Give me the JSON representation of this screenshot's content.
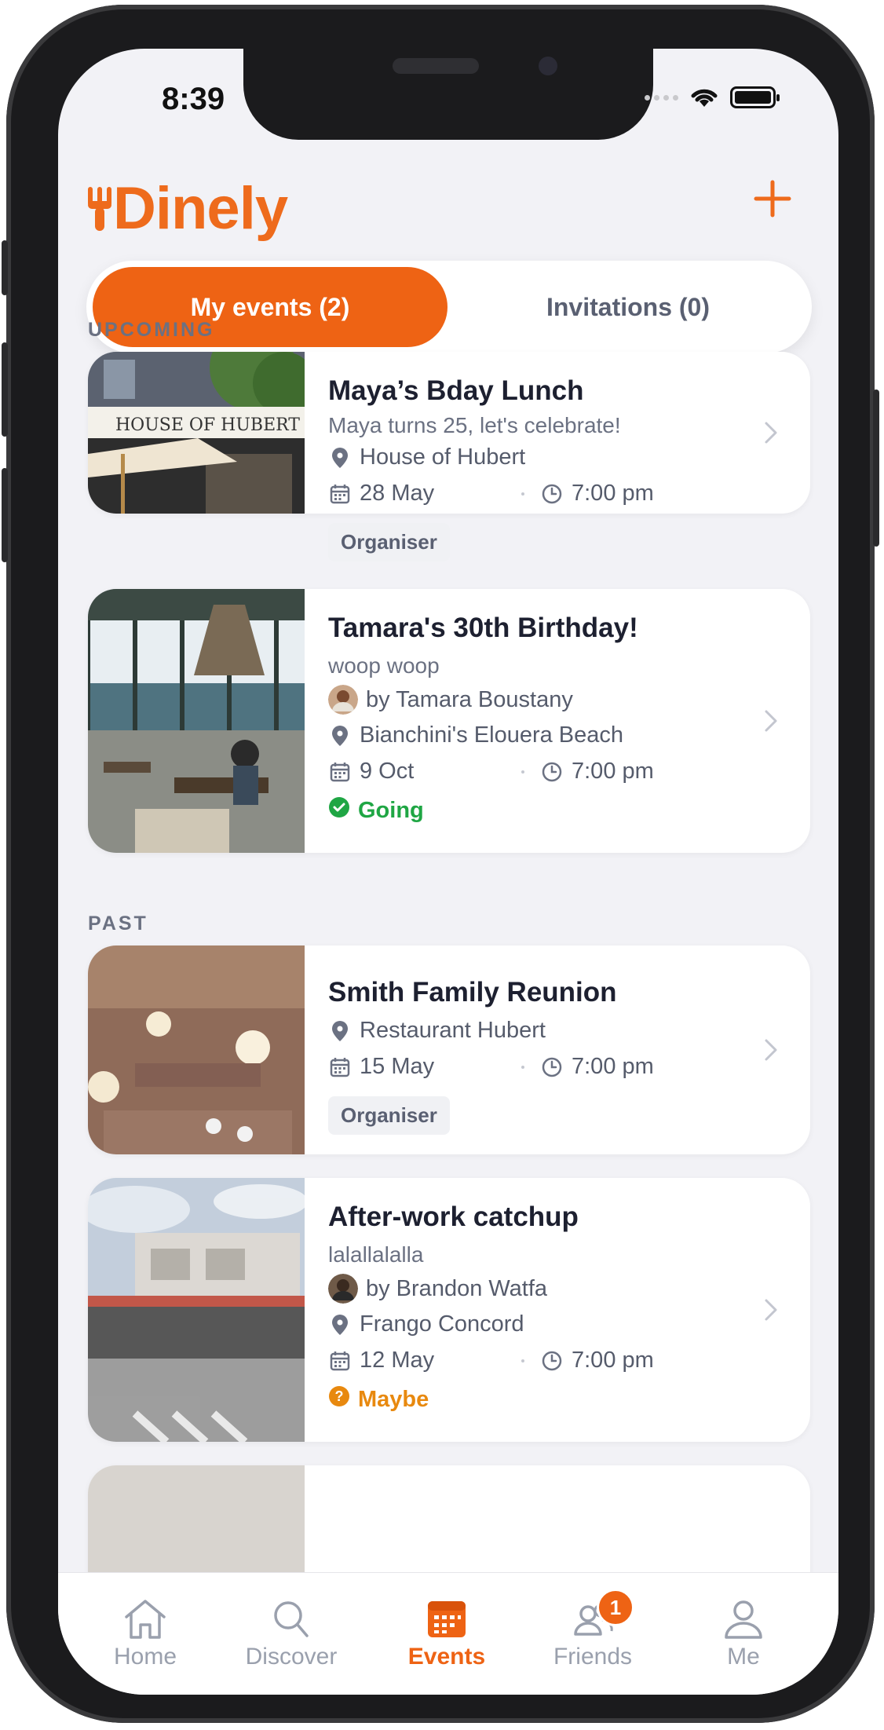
{
  "status_bar": {
    "time": "8:39"
  },
  "app": {
    "name": "Dinely",
    "name_prefix": "D",
    "name_rest": "inely"
  },
  "segments": {
    "my_events": "My events (2)",
    "invitations": "Invitations (0)"
  },
  "sections": {
    "upcoming": "UPCOMING",
    "past": "PAST"
  },
  "events": [
    {
      "title": "Maya’s Bday Lunch",
      "subtitle": "Maya turns 25, let's celebrate!",
      "venue": "House of Hubert",
      "date": "28 May",
      "time": "7:00 pm",
      "tag": "Organiser",
      "image_sign": "HOUSE OF HUBERT"
    },
    {
      "title": "Tamara's 30th Birthday!",
      "subtitle": "woop woop",
      "host": "by Tamara Boustany",
      "venue": "Bianchini's Elouera Beach",
      "date": "9 Oct",
      "time": "7:00 pm",
      "status": "Going"
    },
    {
      "title": "Smith Family Reunion",
      "venue": "Restaurant Hubert",
      "date": "15 May",
      "time": "7:00 pm",
      "tag": "Organiser"
    },
    {
      "title": "After-work catchup",
      "subtitle": "lalallalalla",
      "host": "by Brandon Watfa",
      "venue": "Frango Concord",
      "date": "12 May",
      "time": "7:00 pm",
      "status": "Maybe"
    }
  ],
  "tabbar": {
    "home": "Home",
    "discover": "Discover",
    "events": "Events",
    "friends": "Friends",
    "friends_badge": "1",
    "me": "Me"
  },
  "colors": {
    "accent": "#ee6314",
    "going": "#1fa644",
    "maybe": "#e8890f"
  },
  "icons": [
    "plus-icon",
    "location-pin-icon",
    "calendar-icon",
    "clock-icon",
    "chevron-right-icon",
    "check-circle-icon",
    "question-circle-icon",
    "home-icon",
    "search-icon",
    "calendar-tab-icon",
    "friends-icon",
    "person-icon",
    "wifi-icon",
    "battery-icon"
  ]
}
